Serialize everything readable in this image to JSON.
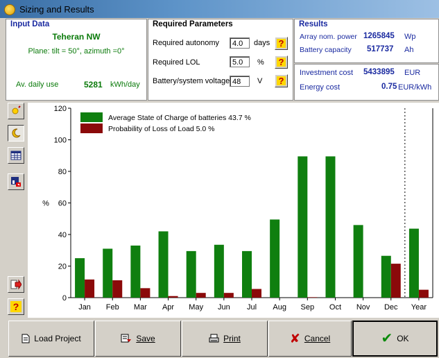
{
  "window": {
    "title": "Sizing and Results"
  },
  "input_data": {
    "heading": "Input Data",
    "site": "Teheran NW",
    "plane": "Plane: tilt = 50°, azimuth =0°",
    "daily_use_label": "Av. daily use",
    "daily_use_value": "5281",
    "daily_use_unit": "kWh/day"
  },
  "required": {
    "heading": "Required Parameters",
    "autonomy_label": "Required autonomy",
    "autonomy_value": "4.0",
    "autonomy_unit": "days",
    "lol_label": "Required LOL",
    "lol_value": "5.0",
    "lol_unit": "%",
    "voltage_label": "Battery/system voltage",
    "voltage_value": "48",
    "voltage_unit": "V",
    "help": "?"
  },
  "results": {
    "heading": "Results",
    "array_label": "Array nom. power",
    "array_value": "1265845",
    "array_unit": "Wp",
    "battery_label": "Battery capacity",
    "battery_value": "517737",
    "battery_unit": "Ah",
    "invest_label": "Investment cost",
    "invest_value": "5433895",
    "invest_unit": "EUR",
    "energy_label": "Energy cost",
    "energy_value": "0.75",
    "energy_unit": "EUR/kWh"
  },
  "toolbar": {
    "help": "?",
    "icons": [
      "sun-icon",
      "moon-icon",
      "table-icon",
      "chart-icon",
      "export-icon",
      "help-icon"
    ]
  },
  "chart_data": {
    "type": "bar",
    "ylabel": "%",
    "ylim": [
      0,
      120
    ],
    "yticks": [
      "0",
      "20",
      "40",
      "60",
      "80",
      "100",
      "120"
    ],
    "categories": [
      "Jan",
      "Feb",
      "Mar",
      "Apr",
      "May",
      "Jun",
      "Jul",
      "Aug",
      "Sep",
      "Oct",
      "Nov",
      "Dec",
      "Year"
    ],
    "series": [
      {
        "name": "Average State of Charge of batteries",
        "legend_value": "43.7 %",
        "color": "#0f7f0f",
        "values": [
          25,
          31,
          33,
          42,
          29.5,
          33.5,
          29.5,
          49.5,
          89.5,
          89.5,
          46,
          26.5,
          43.7
        ]
      },
      {
        "name": "Probability of Loss of Load",
        "legend_value": "5.0 %",
        "color": "#8b0a0a",
        "values": [
          11.5,
          11,
          6,
          1,
          3,
          3,
          5.5,
          0,
          0.3,
          0,
          0,
          21.5,
          5
        ]
      }
    ],
    "grid": false,
    "legend": "top-left"
  },
  "buttons": {
    "load": "Load Project",
    "save": "Save",
    "print": "Print",
    "cancel": "Cancel",
    "ok": "OK"
  },
  "colors": {
    "accent_green": "#0a7a0a",
    "accent_blue": "#1a2aa0",
    "cancel_red": "#c00000"
  }
}
